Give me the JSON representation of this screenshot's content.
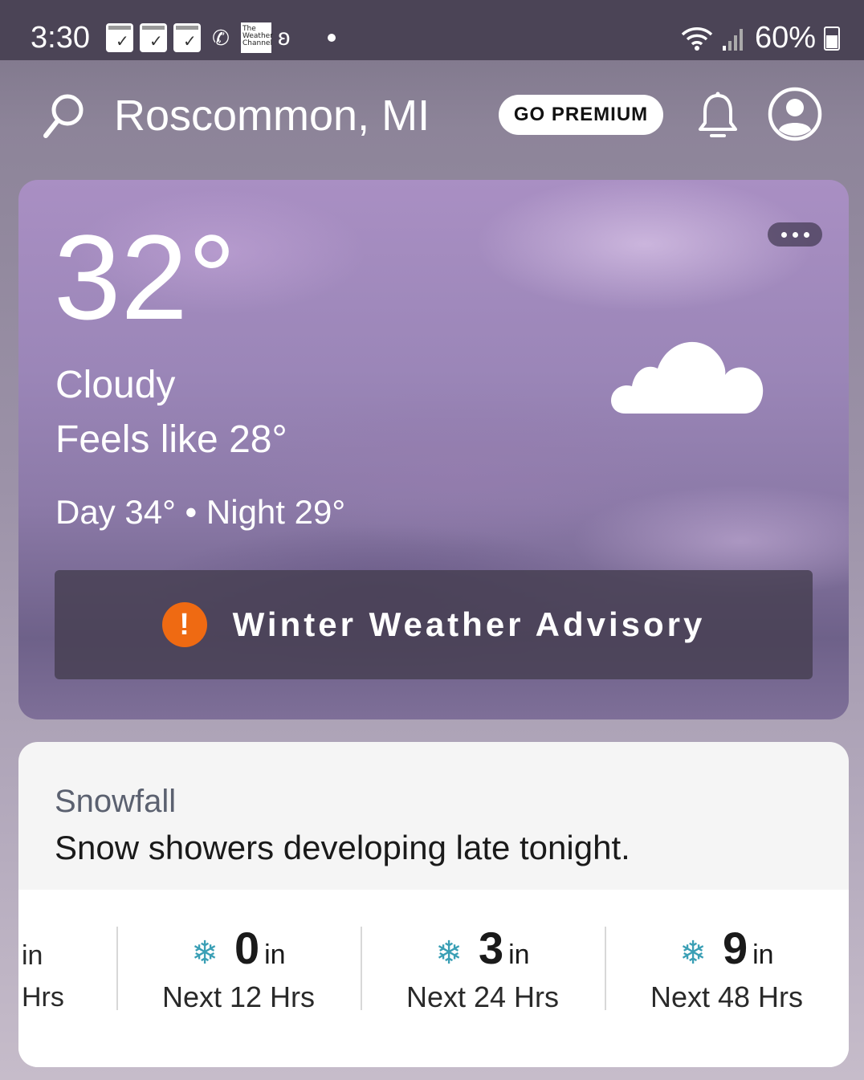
{
  "status_bar": {
    "time": "3:30",
    "battery": "60%",
    "icons": [
      "call-filter-icon",
      "call-filter-icon",
      "call-filter-icon",
      "wifi-calling-icon",
      "weather-channel-icon",
      "hearing-icon",
      "dot-icon",
      "wifi-icon",
      "signal-icon",
      "battery-icon"
    ],
    "call_filter_label": "call filter",
    "twc_label": "The Weather Channel"
  },
  "header": {
    "location": "Roscommon, MI",
    "premium_label": "GO PREMIUM"
  },
  "current": {
    "temperature": "32°",
    "condition": "Cloudy",
    "feels_like": "Feels like 28°",
    "day_night": "Day 34° • Night 29°",
    "icon": "cloud-icon"
  },
  "advisory": {
    "label": "Winter Weather Advisory",
    "color": "#ef6a12"
  },
  "snowfall": {
    "title": "Snowfall",
    "description": "Snow showers developing late tonight.",
    "partial_item": {
      "unit": "in",
      "period": "Hrs"
    },
    "items": [
      {
        "value": "0",
        "unit": "in",
        "period": "Next 12 Hrs"
      },
      {
        "value": "3",
        "unit": "in",
        "period": "Next 24 Hrs"
      },
      {
        "value": "9",
        "unit": "in",
        "period": "Next 48 Hrs"
      }
    ],
    "accent": "#3a9fb5"
  }
}
